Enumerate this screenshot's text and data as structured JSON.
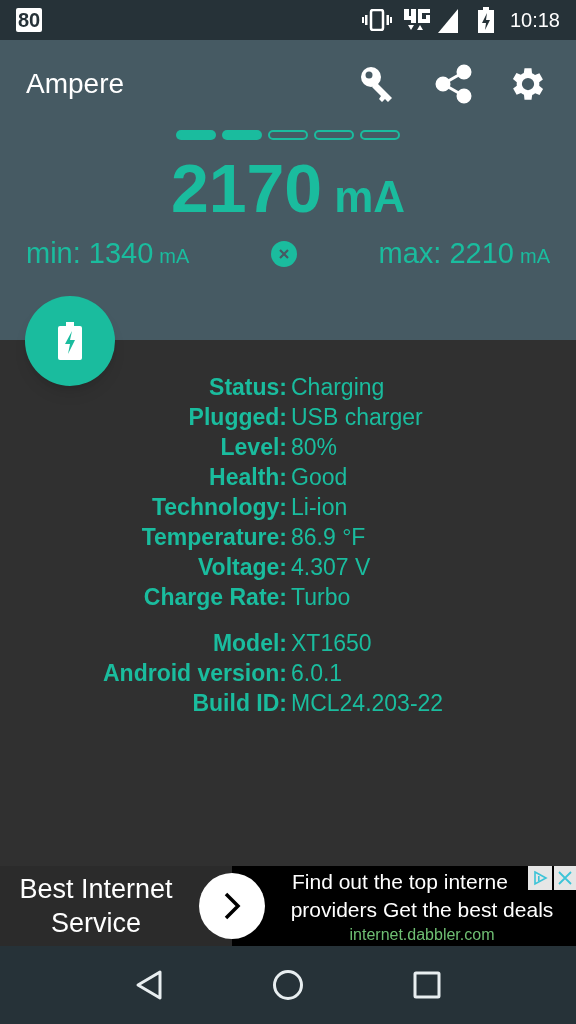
{
  "status_bar": {
    "notification": "80",
    "time": "10:18"
  },
  "app_bar": {
    "title": "Ampere"
  },
  "pager": [
    {
      "filled": true
    },
    {
      "filled": true
    },
    {
      "filled": false
    },
    {
      "filled": false
    },
    {
      "filled": false
    }
  ],
  "reading": {
    "value": "2170",
    "unit": "mA"
  },
  "min": {
    "label": "min: 1340",
    "unit": "mA"
  },
  "max": {
    "label": "max: 2210",
    "unit": "mA"
  },
  "info_groups": [
    [
      {
        "label": "Status:",
        "value": "Charging"
      },
      {
        "label": "Plugged:",
        "value": "USB charger"
      },
      {
        "label": "Level:",
        "value": "80%"
      },
      {
        "label": "Health:",
        "value": "Good"
      },
      {
        "label": "Technology:",
        "value": "Li-ion"
      },
      {
        "label": "Temperature:",
        "value": "86.9 °F"
      },
      {
        "label": "Voltage:",
        "value": "4.307 V"
      },
      {
        "label": "Charge Rate:",
        "value": "Turbo"
      }
    ],
    [
      {
        "label": "Model:",
        "value": "XT1650"
      },
      {
        "label": "Android version:",
        "value": "6.0.1"
      },
      {
        "label": "Build ID:",
        "value": "MCL24.203-22"
      }
    ]
  ],
  "ad": {
    "headline": "Best Internet Service",
    "text_lines": [
      "Find out the top interne",
      "providers Get the best deals"
    ],
    "url": "internet.dabbler.com"
  }
}
